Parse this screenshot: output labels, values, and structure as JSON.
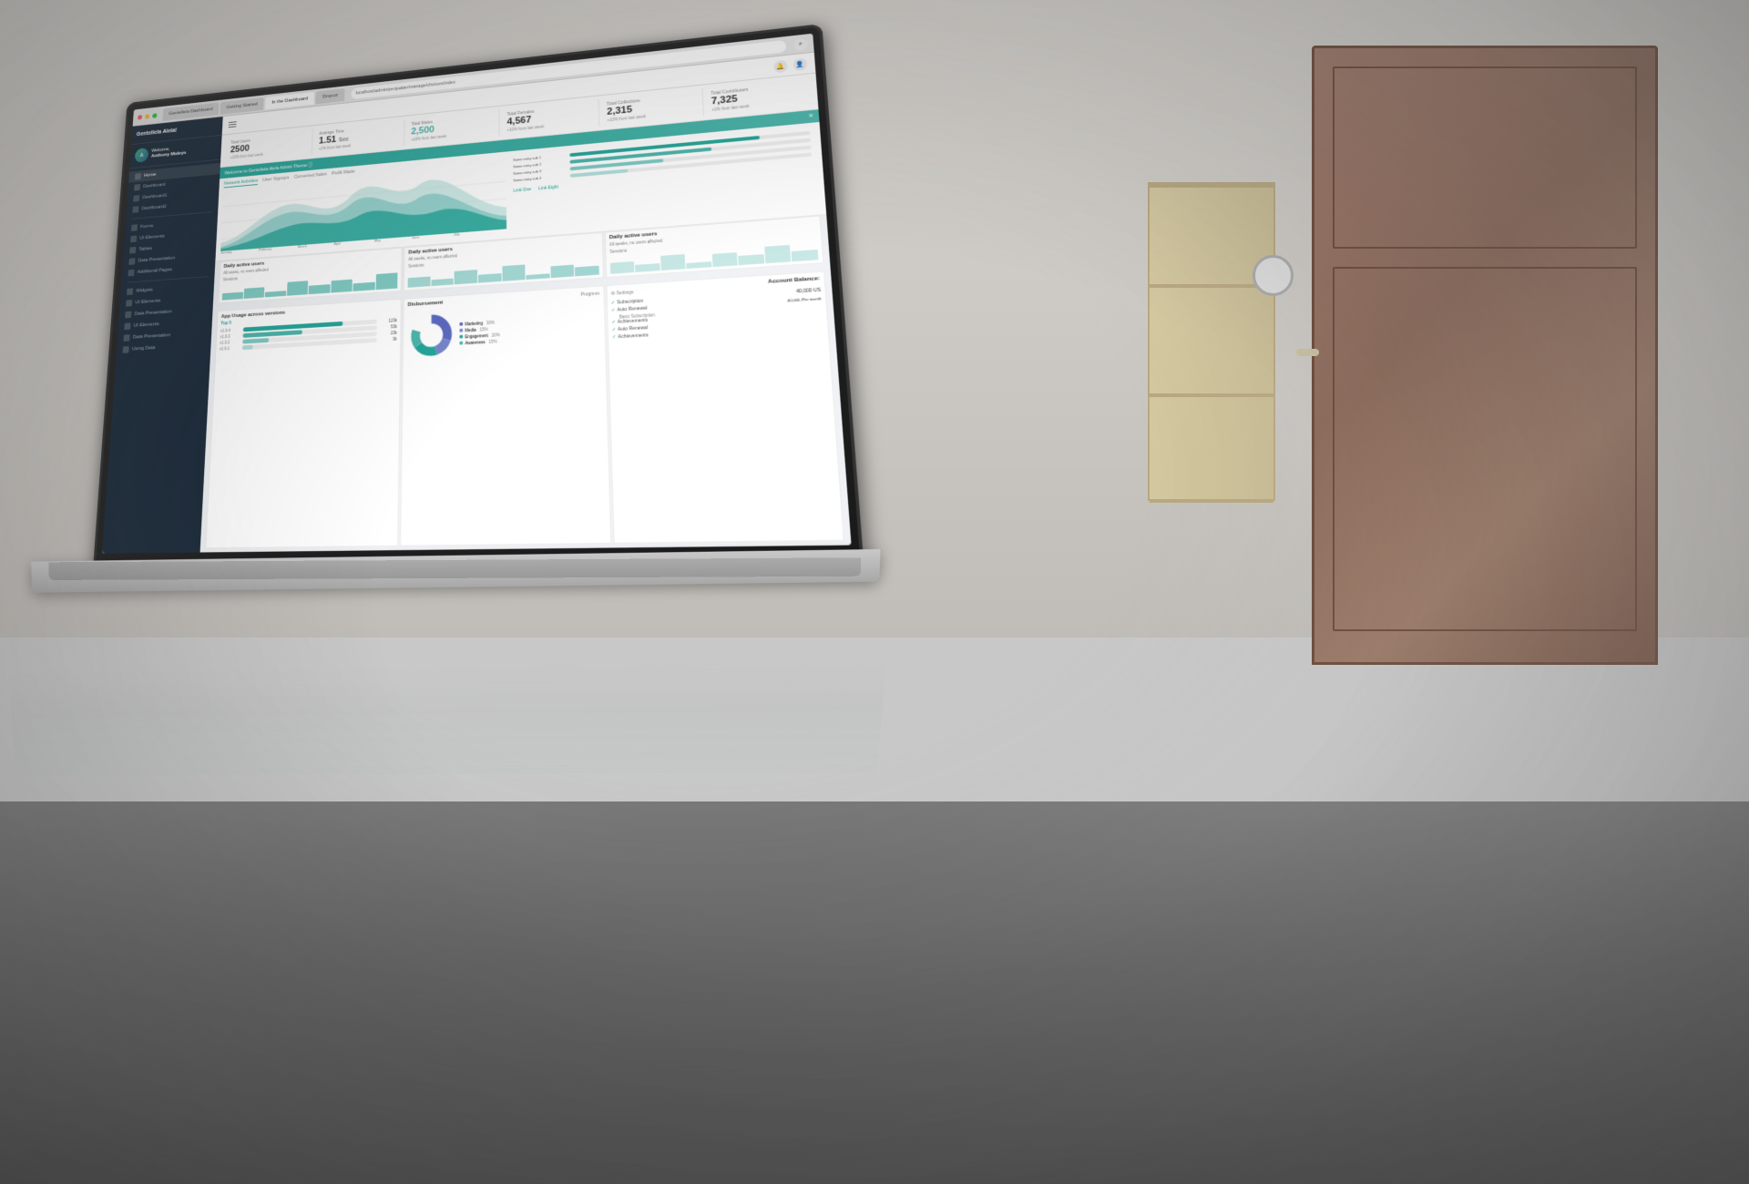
{
  "browser": {
    "tabs": [
      {
        "label": "Gentellela Dashboard",
        "active": false
      },
      {
        "label": "Getting Started",
        "active": false
      },
      {
        "label": "In the Dashboard",
        "active": true
      },
      {
        "label": "Dropoz",
        "active": false
      }
    ],
    "address": "localhost/admin/penjualan/manage/choices/index",
    "search": "In the Dashboard"
  },
  "sidebar": {
    "brand": "Gentellela Alela!",
    "user": {
      "welcome": "Welcome,",
      "name": "Anthony Muleys"
    },
    "nav_items": [
      {
        "label": "Home",
        "icon": "home",
        "active": true
      },
      {
        "label": "Dashboard",
        "icon": "dashboard",
        "active": false
      },
      {
        "label": "Dashboard1",
        "icon": "dashboard",
        "active": false
      },
      {
        "label": "Dashboard2",
        "icon": "dashboard",
        "active": false
      },
      {
        "label": "Forms",
        "icon": "forms",
        "active": false
      },
      {
        "label": "UI Elements",
        "icon": "ui",
        "active": false
      },
      {
        "label": "Tables",
        "icon": "tables",
        "active": false
      },
      {
        "label": "Data Presentation",
        "icon": "data",
        "active": false
      },
      {
        "label": "Additional Pages",
        "icon": "pages",
        "active": false
      }
    ],
    "nav_items2": [
      {
        "label": "Widgets",
        "icon": "widgets"
      },
      {
        "label": "UI Elements",
        "icon": "ui"
      },
      {
        "label": "Data Presentation",
        "icon": "data"
      },
      {
        "label": "UI Elements",
        "icon": "ui"
      },
      {
        "label": "Data Presentation",
        "icon": "data"
      },
      {
        "label": "Using Data",
        "icon": "data"
      }
    ]
  },
  "stats": [
    {
      "label": "Total Users",
      "value": "2500",
      "sub": "+10% from last week",
      "highlight": false
    },
    {
      "label": "Avarage Time",
      "value": "1.51",
      "unit": "Sec",
      "sub": "+1% from last week",
      "highlight": false
    },
    {
      "label": "Total Males",
      "value": "2,500",
      "sub": "+10% from last week",
      "highlight": true
    },
    {
      "label": "Total Females",
      "value": "4,567",
      "sub": "+10% from last week",
      "highlight": false
    },
    {
      "label": "Total Collections",
      "value": "2,315",
      "sub": "+10% from last week",
      "highlight": false
    },
    {
      "label": "Total Contributers",
      "value": "7,325",
      "sub": "+1% from last week",
      "highlight": false
    }
  ],
  "welcome_banner": {
    "text": "Welcome to Gentellela Alela Admin Theme ⓘ"
  },
  "chart": {
    "tabs": [
      "Network Activities",
      "User Signups",
      "Converted Sales",
      "Profit Made"
    ],
    "active_tab": "Network Activities",
    "x_labels": [
      "January",
      "February",
      "March",
      "April",
      "May",
      "June",
      "July"
    ],
    "legend": [
      {
        "label": "Some entry sub 1",
        "value": 80,
        "color": "#26a69a"
      },
      {
        "label": "Some entry sub 2",
        "value": 60,
        "color": "#4db6ac"
      },
      {
        "label": "Some entry sub 3",
        "value": 40,
        "color": "#80cbc4"
      },
      {
        "label": "Some entry sub 4",
        "value": 25,
        "color": "#b2dfdb"
      }
    ],
    "links": [
      "Link One",
      "Link Eight"
    ]
  },
  "daily_active": [
    {
      "title": "Daily active users",
      "subtitle": "All weeks, no users affected",
      "sub2": "Sessions"
    },
    {
      "title": "Daily active users",
      "subtitle": "All weeks, no users affected",
      "sub2": "Sessions"
    },
    {
      "title": "Daily active users",
      "subtitle": "All weeks, no users affected",
      "sub2": "Sessions"
    }
  ],
  "app_usage": {
    "title": "App Usage across versions",
    "items": [
      {
        "label": "v1.9.4",
        "value": 75,
        "display": "123k",
        "color": "#4db6ac"
      },
      {
        "label": "v1.9.3",
        "value": 45,
        "display": "53k",
        "color": "#4db6ac"
      },
      {
        "label": "v1.9.2",
        "value": 20,
        "display": "23k",
        "color": "#80cbc4"
      },
      {
        "label": "v1.9.1",
        "value": 10,
        "display": "3k",
        "color": "#b2dfdb"
      }
    ],
    "top5_label": "Top 5"
  },
  "disbursement": {
    "title": "Disbursement",
    "subtitle": "Progress",
    "segments": [
      {
        "label": "Marketing",
        "value": 30,
        "color": "#5c6bc0"
      },
      {
        "label": "Media",
        "value": 15,
        "color": "#7986cb"
      },
      {
        "label": "Engagement",
        "value": 20,
        "color": "#26a69a"
      },
      {
        "label": "Awareness",
        "value": 15,
        "color": "#4db6ac"
      }
    ]
  },
  "account": {
    "title": "Account Balance:",
    "items": [
      {
        "label": "Settings"
      },
      {
        "label": "Subscription",
        "amount": "40,000 US"
      },
      {
        "label": "Auto Renewal",
        "amount": "40,000 /Per month"
      },
      {
        "label": "Basic Subscription"
      },
      {
        "label": "Achievements"
      },
      {
        "label": "Auto Renewal"
      },
      {
        "label": "Achievements"
      }
    ]
  }
}
